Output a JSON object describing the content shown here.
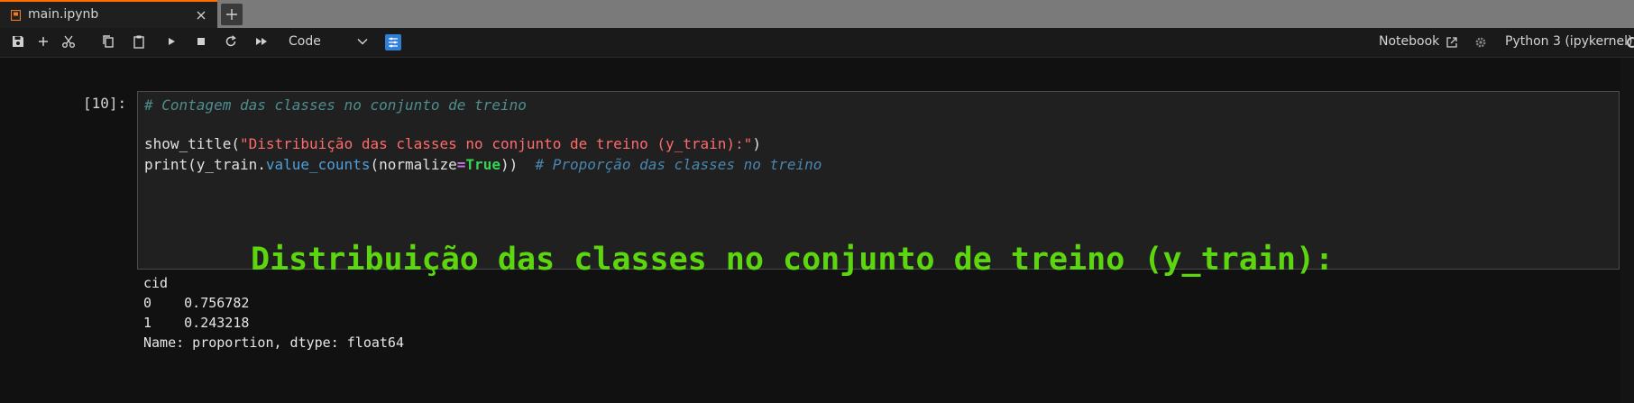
{
  "tab": {
    "filename": "main.ipynb",
    "accent_color": "#ff6d00"
  },
  "toolbar": {
    "buttons": [
      "save-icon",
      "add-cell-icon",
      "cut-icon",
      "copy-icon",
      "paste-icon",
      "run-icon",
      "stop-icon",
      "restart-icon",
      "run-all-icon"
    ],
    "cell_type": "Code",
    "notebook_link": "Notebook",
    "kernel": "Python 3 (ipykernel)"
  },
  "cell": {
    "execution_count": "[10]:",
    "code": {
      "line1_comment": "# Contagem das classes no conjunto de treino",
      "line3_func": "show_title(",
      "line3_string": "\"Distribuição das classes no conjunto de treino (y_train):\"",
      "line3_close": ")",
      "line4_print": "print(y_train.",
      "line4_method": "value_counts",
      "line4_arg": "(normalize",
      "line4_eq": "=",
      "line4_bool": "True",
      "line4_close": "))",
      "line4_comment": "# Proporção das classes no treino"
    }
  },
  "output": {
    "title": "Distribuição das classes no conjunto de treino (y_train):",
    "title_color": "#5cd60e",
    "lines": [
      "cid",
      "0    0.756782",
      "1    0.243218",
      "Name: proportion, dtype: float64"
    ]
  }
}
